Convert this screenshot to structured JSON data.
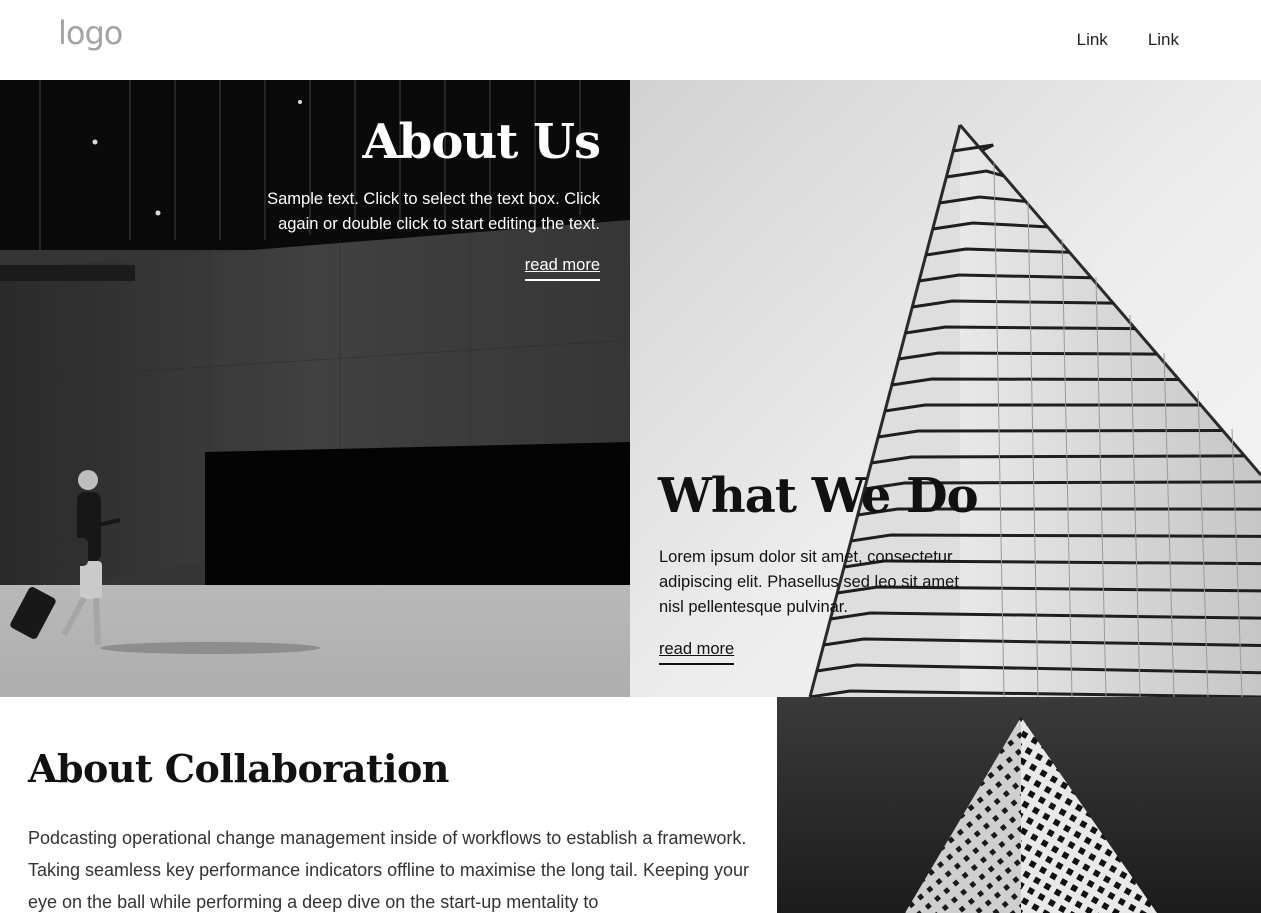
{
  "header": {
    "logo_text": "logo",
    "nav": [
      {
        "label": "Link"
      },
      {
        "label": "Link"
      }
    ]
  },
  "about_us": {
    "title": "About Us",
    "text": "Sample text. Click to select the text box. Click again or double click to start editing the text.",
    "link_label": "read more"
  },
  "what_we_do": {
    "title": "What We Do",
    "text": "Lorem ipsum dolor sit amet, consectetur adipiscing elit. Phasellus sed leo sit amet nisl pellentesque pulvinar.",
    "link_label": "read more"
  },
  "collaboration": {
    "title": "About Collaboration",
    "text": "Podcasting operational change management inside of workflows to establish a framework. Taking seamless key performance indicators offline to maximise the long tail. Keeping your eye on the ball while performing a deep dive on the start-up mentality to"
  },
  "images": {
    "left_panel": "building-with-walking-woman-photo",
    "right_panel": "skyscraper-glass-facade-photo",
    "bottom_panel": "patterned-tower-photo"
  }
}
